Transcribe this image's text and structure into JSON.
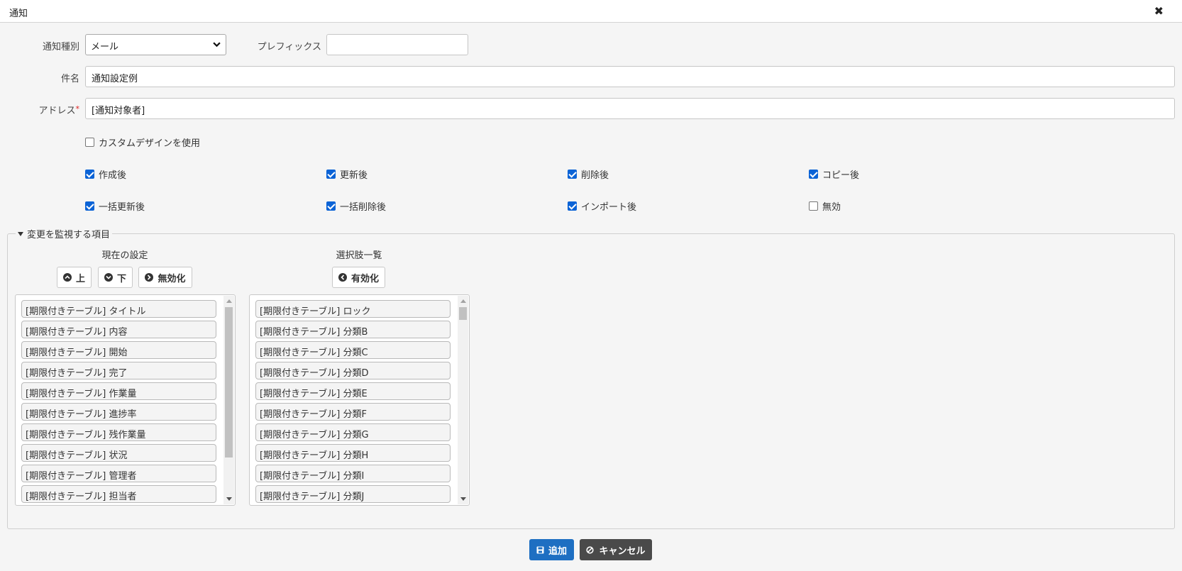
{
  "dialog": {
    "title": "通知",
    "close_icon": "✖"
  },
  "form": {
    "type_label": "通知種別",
    "type_value": "メール",
    "prefix_label": "プレフィックス",
    "prefix_value": "",
    "subject_label": "件名",
    "subject_value": "通知設定例",
    "address_label": "アドレス",
    "address_required_mark": "*",
    "address_value": "[通知対象者]"
  },
  "custom_design": {
    "label": "カスタムデザインを使用",
    "checked": false
  },
  "triggers": [
    {
      "label": "作成後",
      "checked": true
    },
    {
      "label": "更新後",
      "checked": true
    },
    {
      "label": "削除後",
      "checked": true
    },
    {
      "label": "コピー後",
      "checked": true
    },
    {
      "label": "一括更新後",
      "checked": true
    },
    {
      "label": "一括削除後",
      "checked": true
    },
    {
      "label": "インポート後",
      "checked": true
    },
    {
      "label": "無効",
      "checked": false
    }
  ],
  "monitor": {
    "legend": "変更を監視する項目",
    "current_title": "現在の設定",
    "choices_title": "選択肢一覧",
    "btn_up": "上",
    "btn_down": "下",
    "btn_disable": "無効化",
    "btn_enable": "有効化",
    "current_items": [
      "[期限付きテーブル] タイトル",
      "[期限付きテーブル] 内容",
      "[期限付きテーブル] 開始",
      "[期限付きテーブル] 完了",
      "[期限付きテーブル] 作業量",
      "[期限付きテーブル] 進捗率",
      "[期限付きテーブル] 残作業量",
      "[期限付きテーブル] 状況",
      "[期限付きテーブル] 管理者",
      "[期限付きテーブル] 担当者"
    ],
    "choice_items": [
      "[期限付きテーブル] ロック",
      "[期限付きテーブル] 分類B",
      "[期限付きテーブル] 分類C",
      "[期限付きテーブル] 分類D",
      "[期限付きテーブル] 分類E",
      "[期限付きテーブル] 分類F",
      "[期限付きテーブル] 分類G",
      "[期限付きテーブル] 分類H",
      "[期限付きテーブル] 分類I",
      "[期限付きテーブル] 分類J"
    ]
  },
  "footer": {
    "add_label": "追加",
    "cancel_label": "キャンセル"
  },
  "colors": {
    "primary": "#1e6fc2",
    "dark": "#4a4a4a",
    "check": "#0b63d6",
    "required": "#e02020"
  }
}
